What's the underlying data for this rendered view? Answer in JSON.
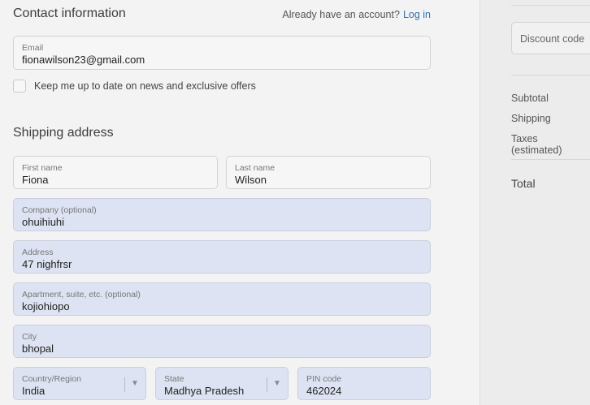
{
  "contact": {
    "title": "Contact information",
    "login_prompt": "Already have an account?",
    "login_link": "Log in",
    "email_label": "Email",
    "email_value": "fionawilson23@gmail.com",
    "newsletter_label": "Keep me up to date on news and exclusive offers"
  },
  "shipping": {
    "title": "Shipping address",
    "first_name_label": "First name",
    "first_name_value": "Fiona",
    "last_name_label": "Last name",
    "last_name_value": "Wilson",
    "company_label": "Company (optional)",
    "company_value": "ohuihiuhi",
    "address_label": "Address",
    "address_value": "47 nighfrsr",
    "apartment_label": "Apartment, suite, etc. (optional)",
    "apartment_value": "kojiohiopo",
    "city_label": "City",
    "city_value": "bhopal",
    "country_label": "Country/Region",
    "country_value": "India",
    "state_label": "State",
    "state_value": "Madhya Pradesh",
    "pin_label": "PIN code",
    "pin_value": "462024"
  },
  "summary": {
    "discount_placeholder": "Discount code",
    "subtotal_label": "Subtotal",
    "shipping_label": "Shipping",
    "taxes_label": "Taxes (estimated)",
    "total_label": "Total"
  },
  "colors": {
    "link": "#2f6fb5",
    "autofill": "#dde3f2"
  },
  "icons": {
    "select_chevron": "chevron-down-icon"
  }
}
